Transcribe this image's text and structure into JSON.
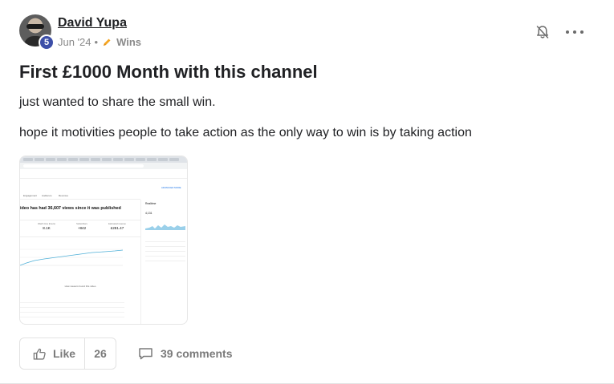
{
  "author": {
    "name": "David Yupa",
    "level": "5"
  },
  "meta": {
    "date": "Jun '24",
    "separator": "•",
    "category": "Wins",
    "category_icon": "pencil-icon",
    "category_icon_color": "#f5a623"
  },
  "actions": {
    "bell_icon": "bell-off-icon",
    "more_icon": "more-options-icon"
  },
  "post": {
    "title": "First £1000 Month with this channel",
    "paragraphs": [
      "just wanted to share the small win.",
      "hope it motivities people to take action as the only way to win is by taking action"
    ]
  },
  "attachment": {
    "tabs": [
      "Engagement",
      "Audience",
      "Revenue"
    ],
    "headline": "ideo has had 36,607 views since it was published",
    "cards": [
      {
        "label": "Watch time (hours)",
        "value": "8.1K"
      },
      {
        "label": "Subscribers",
        "value": "+842"
      },
      {
        "label": "Estimated revenue",
        "value": "£281.47"
      }
    ],
    "section_label": "How viewers found this video",
    "side_title": "Realtime",
    "side_value": "4,131",
    "advanced_link": "ADVANCED MODE"
  },
  "footer": {
    "like_label": "Like",
    "like_count": "26",
    "comments_label": "39 comments"
  },
  "colors": {
    "level_badge": "#3d4fa8",
    "muted_text": "#7a7a7a",
    "title_text": "#202124"
  }
}
